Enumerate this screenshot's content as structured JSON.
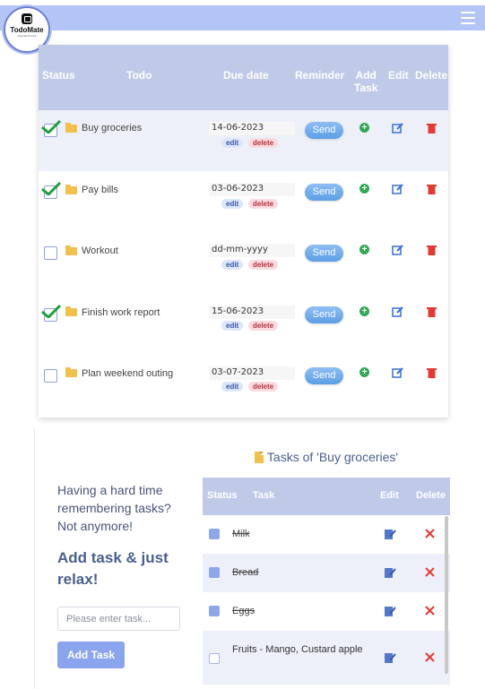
{
  "app": {
    "logo_name": "TodoMate",
    "logo_sub": "todo list & more"
  },
  "main_table": {
    "headers": {
      "status": "Status",
      "todo": "Todo",
      "due_date": "Due date",
      "reminder": "Reminder",
      "add_task_1": "Add",
      "add_task_2": "Task",
      "edit": "Edit",
      "delete": "Delete"
    },
    "rows": [
      {
        "name": "Buy groceries",
        "date": "14-06-2023",
        "checked": true,
        "send": "Send",
        "edit": "edit",
        "delete": "delete"
      },
      {
        "name": "Pay bills",
        "date": "03-06-2023",
        "checked": true,
        "send": "Send",
        "edit": "edit",
        "delete": "delete"
      },
      {
        "name": "Workout",
        "date": "dd-mm-yyyy",
        "checked": false,
        "send": "Send",
        "edit": "edit",
        "delete": "delete"
      },
      {
        "name": "Finish work report",
        "date": "15-06-2023",
        "checked": true,
        "send": "Send",
        "edit": "edit",
        "delete": "delete"
      },
      {
        "name": "Plan weekend outing",
        "date": "03-07-2023",
        "checked": false,
        "send": "Send",
        "edit": "edit",
        "delete": "delete"
      }
    ]
  },
  "promo": {
    "tagline": "Having a hard time remembering tasks? Not anymore!",
    "slogan": "Add task & just relax!",
    "input_placeholder": "Please enter task...",
    "add_button": "Add Task"
  },
  "subtasks": {
    "title": "Tasks of 'Buy groceries'",
    "headers": {
      "status": "Status",
      "task": "Task",
      "edit": "Edit",
      "delete": "Delete"
    },
    "rows": [
      {
        "name": "Milk",
        "done": true
      },
      {
        "name": "Bread",
        "done": true
      },
      {
        "name": "Eggs",
        "done": true
      },
      {
        "name": "Fruits - Mango, Custard apple",
        "done": false
      }
    ]
  },
  "colors": {
    "topbar": "#b3c5f7",
    "table_header": "#bfcae8",
    "row_alt": "#eef0f9",
    "send_button": "#5c9ee5",
    "add_green": "#33a857",
    "edit_blue": "#3a6fd8",
    "delete_red": "#e53935"
  }
}
